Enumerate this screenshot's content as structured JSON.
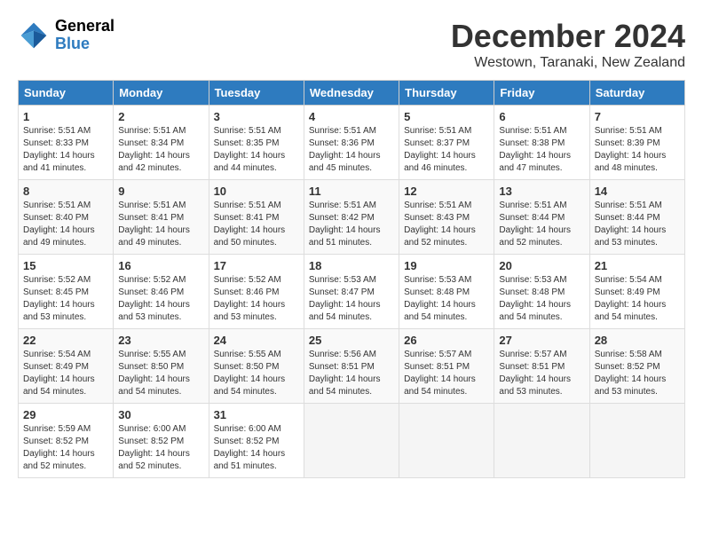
{
  "logo": {
    "line1": "General",
    "line2": "Blue"
  },
  "title": "December 2024",
  "location": "Westown, Taranaki, New Zealand",
  "days_of_week": [
    "Sunday",
    "Monday",
    "Tuesday",
    "Wednesday",
    "Thursday",
    "Friday",
    "Saturday"
  ],
  "weeks": [
    [
      {
        "day": "1",
        "sunrise": "5:51 AM",
        "sunset": "8:33 PM",
        "daylight": "14 hours and 41 minutes."
      },
      {
        "day": "2",
        "sunrise": "5:51 AM",
        "sunset": "8:34 PM",
        "daylight": "14 hours and 42 minutes."
      },
      {
        "day": "3",
        "sunrise": "5:51 AM",
        "sunset": "8:35 PM",
        "daylight": "14 hours and 44 minutes."
      },
      {
        "day": "4",
        "sunrise": "5:51 AM",
        "sunset": "8:36 PM",
        "daylight": "14 hours and 45 minutes."
      },
      {
        "day": "5",
        "sunrise": "5:51 AM",
        "sunset": "8:37 PM",
        "daylight": "14 hours and 46 minutes."
      },
      {
        "day": "6",
        "sunrise": "5:51 AM",
        "sunset": "8:38 PM",
        "daylight": "14 hours and 47 minutes."
      },
      {
        "day": "7",
        "sunrise": "5:51 AM",
        "sunset": "8:39 PM",
        "daylight": "14 hours and 48 minutes."
      }
    ],
    [
      {
        "day": "8",
        "sunrise": "5:51 AM",
        "sunset": "8:40 PM",
        "daylight": "14 hours and 49 minutes."
      },
      {
        "day": "9",
        "sunrise": "5:51 AM",
        "sunset": "8:41 PM",
        "daylight": "14 hours and 49 minutes."
      },
      {
        "day": "10",
        "sunrise": "5:51 AM",
        "sunset": "8:41 PM",
        "daylight": "14 hours and 50 minutes."
      },
      {
        "day": "11",
        "sunrise": "5:51 AM",
        "sunset": "8:42 PM",
        "daylight": "14 hours and 51 minutes."
      },
      {
        "day": "12",
        "sunrise": "5:51 AM",
        "sunset": "8:43 PM",
        "daylight": "14 hours and 52 minutes."
      },
      {
        "day": "13",
        "sunrise": "5:51 AM",
        "sunset": "8:44 PM",
        "daylight": "14 hours and 52 minutes."
      },
      {
        "day": "14",
        "sunrise": "5:51 AM",
        "sunset": "8:44 PM",
        "daylight": "14 hours and 53 minutes."
      }
    ],
    [
      {
        "day": "15",
        "sunrise": "5:52 AM",
        "sunset": "8:45 PM",
        "daylight": "14 hours and 53 minutes."
      },
      {
        "day": "16",
        "sunrise": "5:52 AM",
        "sunset": "8:46 PM",
        "daylight": "14 hours and 53 minutes."
      },
      {
        "day": "17",
        "sunrise": "5:52 AM",
        "sunset": "8:46 PM",
        "daylight": "14 hours and 53 minutes."
      },
      {
        "day": "18",
        "sunrise": "5:53 AM",
        "sunset": "8:47 PM",
        "daylight": "14 hours and 54 minutes."
      },
      {
        "day": "19",
        "sunrise": "5:53 AM",
        "sunset": "8:48 PM",
        "daylight": "14 hours and 54 minutes."
      },
      {
        "day": "20",
        "sunrise": "5:53 AM",
        "sunset": "8:48 PM",
        "daylight": "14 hours and 54 minutes."
      },
      {
        "day": "21",
        "sunrise": "5:54 AM",
        "sunset": "8:49 PM",
        "daylight": "14 hours and 54 minutes."
      }
    ],
    [
      {
        "day": "22",
        "sunrise": "5:54 AM",
        "sunset": "8:49 PM",
        "daylight": "14 hours and 54 minutes."
      },
      {
        "day": "23",
        "sunrise": "5:55 AM",
        "sunset": "8:50 PM",
        "daylight": "14 hours and 54 minutes."
      },
      {
        "day": "24",
        "sunrise": "5:55 AM",
        "sunset": "8:50 PM",
        "daylight": "14 hours and 54 minutes."
      },
      {
        "day": "25",
        "sunrise": "5:56 AM",
        "sunset": "8:51 PM",
        "daylight": "14 hours and 54 minutes."
      },
      {
        "day": "26",
        "sunrise": "5:57 AM",
        "sunset": "8:51 PM",
        "daylight": "14 hours and 54 minutes."
      },
      {
        "day": "27",
        "sunrise": "5:57 AM",
        "sunset": "8:51 PM",
        "daylight": "14 hours and 53 minutes."
      },
      {
        "day": "28",
        "sunrise": "5:58 AM",
        "sunset": "8:52 PM",
        "daylight": "14 hours and 53 minutes."
      }
    ],
    [
      {
        "day": "29",
        "sunrise": "5:59 AM",
        "sunset": "8:52 PM",
        "daylight": "14 hours and 52 minutes."
      },
      {
        "day": "30",
        "sunrise": "6:00 AM",
        "sunset": "8:52 PM",
        "daylight": "14 hours and 52 minutes."
      },
      {
        "day": "31",
        "sunrise": "6:00 AM",
        "sunset": "8:52 PM",
        "daylight": "14 hours and 51 minutes."
      },
      null,
      null,
      null,
      null
    ]
  ],
  "labels": {
    "sunrise": "Sunrise: ",
    "sunset": "Sunset: ",
    "daylight_label": "Daylight: "
  },
  "accent_color": "#2e7bbf"
}
